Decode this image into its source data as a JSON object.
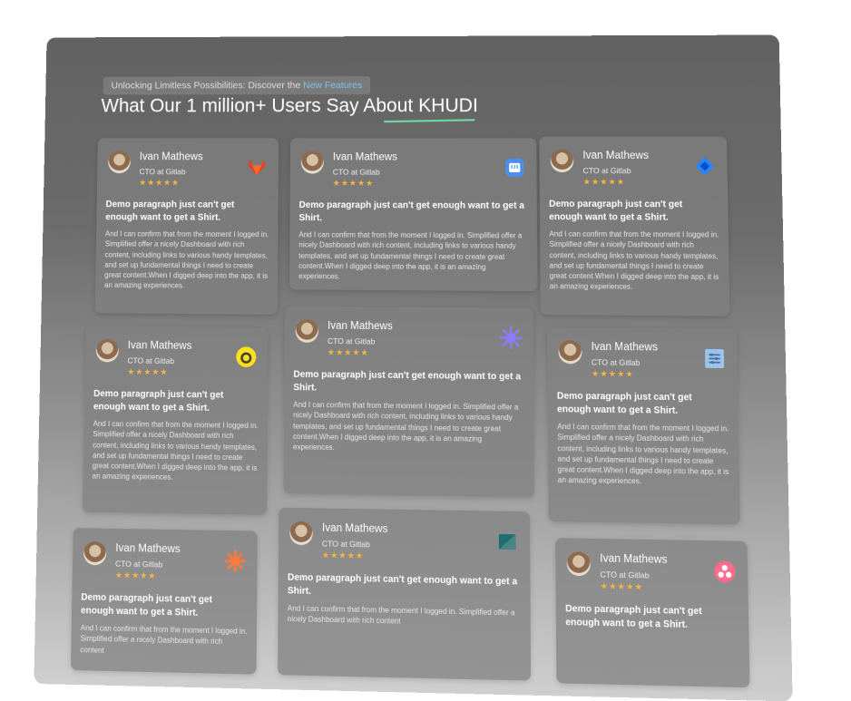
{
  "header": {
    "eyebrow_text": "Unlocking Limitless Possibilities: Discover the",
    "eyebrow_link": "New Features",
    "headline": "What Our 1 million+ Users Say About KHUDI"
  },
  "colors": {
    "star": "#f4b63f",
    "accent_link": "#7cc4f2",
    "underline": "#6fe0a4"
  },
  "testimonials": [
    {
      "name": "Ivan Mathews",
      "role": "CTO at Gitlab",
      "stars": "★★★★★",
      "logo_icon": "gitlab-icon",
      "title": "Demo paragraph just can't get enough want to get a Shirt.",
      "body": "And I can confirm that from the moment I logged in. Simplified offer a nicely Dashboard with rich content, including links to various handy templates, and set up fundamental things I need to create great content.When I digged deep into the app, it is an amazing experiences."
    },
    {
      "name": "Ivan Mathews",
      "role": "CTO at Gitlab",
      "stars": "★★★★★",
      "logo_icon": "blue-app-icon",
      "title": "Demo paragraph just can't get enough want to get a Shirt.",
      "body": "And I can confirm that from the moment I logged in. Simplified offer a nicely Dashboard with rich content, including links to various handy templates, and set up fundamental things I need to create great content.When I digged deep into the app, it is an amazing experiences."
    },
    {
      "name": "Ivan Mathews",
      "role": "CTO at Gitlab",
      "stars": "★★★★★",
      "logo_icon": "jira-icon",
      "title": "Demo paragraph just can't get enough want to get a Shirt.",
      "body": "And I can confirm that from the moment I logged in. Simplified offer a nicely Dashboard with rich content, including links to various handy templates, and set up fundamental things I need to create great content.When I digged deep into the app, it is an amazing experiences."
    },
    {
      "name": "Ivan Mathews",
      "role": "CTO at Gitlab",
      "stars": "★★★★★",
      "logo_icon": "mailchimp-icon",
      "title": "Demo paragraph just can't get enough want to get a Shirt.",
      "body": "And I can confirm that from the moment I logged in. Simplified offer a nicely Dashboard with rich content, including links to various handy templates, and set up fundamental things I need to create great content.When I digged deep into the app, it is an amazing experiences."
    },
    {
      "name": "Ivan Mathews",
      "role": "CTO at Gitlab",
      "stars": "★★★★★",
      "logo_icon": "burst-icon",
      "title": "Demo paragraph just can't get enough want to get a Shirt.",
      "body": "And I can confirm that from the moment I logged in. Simplified offer a nicely Dashboard with rich content, including links to various handy templates, and set up fundamental things I need to create great content.When I digged deep into the app, it is an amazing experiences."
    },
    {
      "name": "Ivan Mathews",
      "role": "CTO at Gitlab",
      "stars": "★★★★★",
      "logo_icon": "list-app-icon",
      "title": "Demo paragraph just can't get enough want to get a Shirt.",
      "body": "And I can confirm that from the moment I logged in. Simplified offer a nicely Dashboard with rich content, including links to various handy templates, and set up fundamental things I need to create great content.When I digged deep into the app, it is an amazing experiences."
    },
    {
      "name": "Ivan Mathews",
      "role": "CTO at Gitlab",
      "stars": "★★★★★",
      "logo_icon": "hubspot-sprocket-icon",
      "title": "Demo paragraph just can't get enough want to get a Shirt.",
      "body": "And I can confirm that from the moment I logged in. Simplified offer a nicely Dashboard with rich content"
    },
    {
      "name": "Ivan Mathews",
      "role": "CTO at Gitlab",
      "stars": "★★★★★",
      "logo_icon": "zendesk-icon",
      "title": "Demo paragraph just can't get enough want to get a Shirt.",
      "body": "And I can confirm that from the moment I logged in. Simplified offer a nicely Dashboard with rich content"
    },
    {
      "name": "Ivan Mathews",
      "role": "CTO at Gitlab",
      "stars": "★★★★★",
      "logo_icon": "asana-icon",
      "title": "Demo paragraph just can't get enough want to get a Shirt.",
      "body": ""
    }
  ]
}
